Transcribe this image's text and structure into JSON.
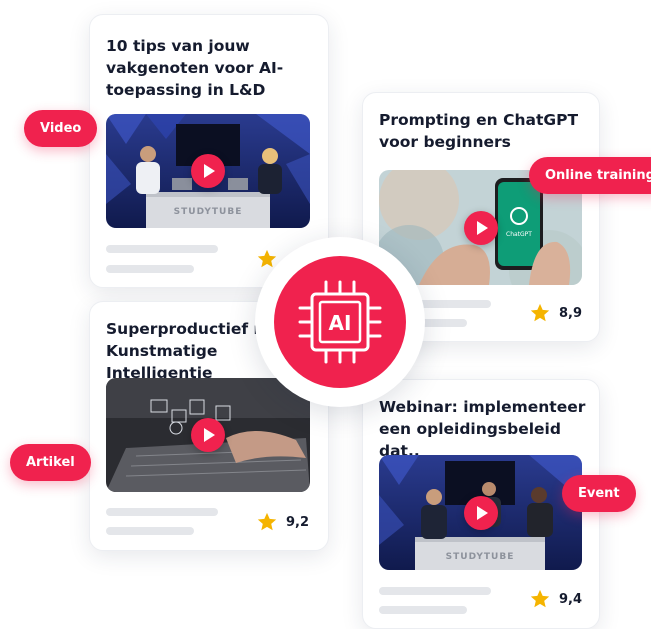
{
  "cards": [
    {
      "title": "10 tips van jouw\nvakgenoten voor AI-\ntoepassing in L&D",
      "rating": ""
    },
    {
      "title": "Prompting en ChatGPT\nvoor beginners",
      "rating": "8,9"
    },
    {
      "title": "Superproductief met\nKunstmatige Intelligentie",
      "rating": "9,2"
    },
    {
      "title": "Webinar: implementeer\neen opleidingsbeleid dat..",
      "rating": "9,4"
    }
  ],
  "tags": {
    "video": "Video",
    "online_training": "Online training",
    "artikel": "Artikel",
    "event": "Event"
  },
  "badge": {
    "label": "AI",
    "icon": "ai-chip-icon"
  },
  "thumb_text": {
    "studytube": "STUDYTUBE",
    "chatgpt": "ChatGPT"
  },
  "colors": {
    "accent": "#f0224e",
    "star": "#f5b400",
    "text": "#151b2e",
    "placeholder": "#e4e6ea"
  }
}
